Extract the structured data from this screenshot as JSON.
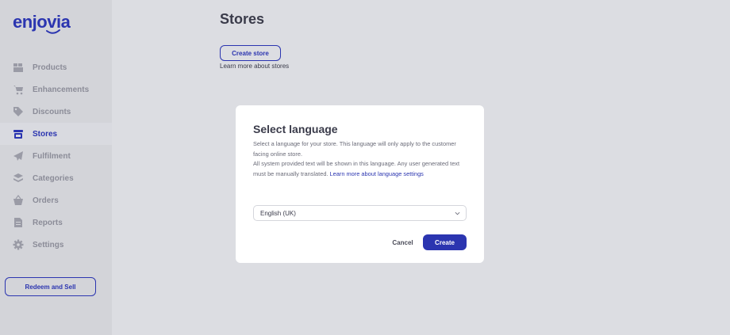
{
  "brand": {
    "logo_text": "enjovia",
    "accent": "#2b35b0"
  },
  "sidebar": {
    "items": [
      {
        "label": "Products",
        "icon": "boxes-icon",
        "active": false
      },
      {
        "label": "Enhancements",
        "icon": "cart-icon",
        "active": false
      },
      {
        "label": "Discounts",
        "icon": "tags-icon",
        "active": false
      },
      {
        "label": "Stores",
        "icon": "store-icon",
        "active": true
      },
      {
        "label": "Fulfilment",
        "icon": "paper-plane-icon",
        "active": false
      },
      {
        "label": "Categories",
        "icon": "layers-icon",
        "active": false
      },
      {
        "label": "Orders",
        "icon": "basket-icon",
        "active": false
      },
      {
        "label": "Reports",
        "icon": "document-icon",
        "active": false
      },
      {
        "label": "Settings",
        "icon": "gear-icon",
        "active": false
      }
    ],
    "redeem_label": "Redeem and Sell"
  },
  "main": {
    "title": "Stores",
    "create_store_label": "Create store",
    "learn_more": "Learn more about stores"
  },
  "modal": {
    "title": "Select language",
    "desc_line1": "Select a language for your store. This language will only apply to the customer facing online store.",
    "desc_line2": "All system provided text will be shown in this language. Any user generated text must be manually translated.",
    "desc_link": "Learn more about language settings",
    "language_value": "English (UK)",
    "cancel_label": "Cancel",
    "create_label": "Create"
  }
}
